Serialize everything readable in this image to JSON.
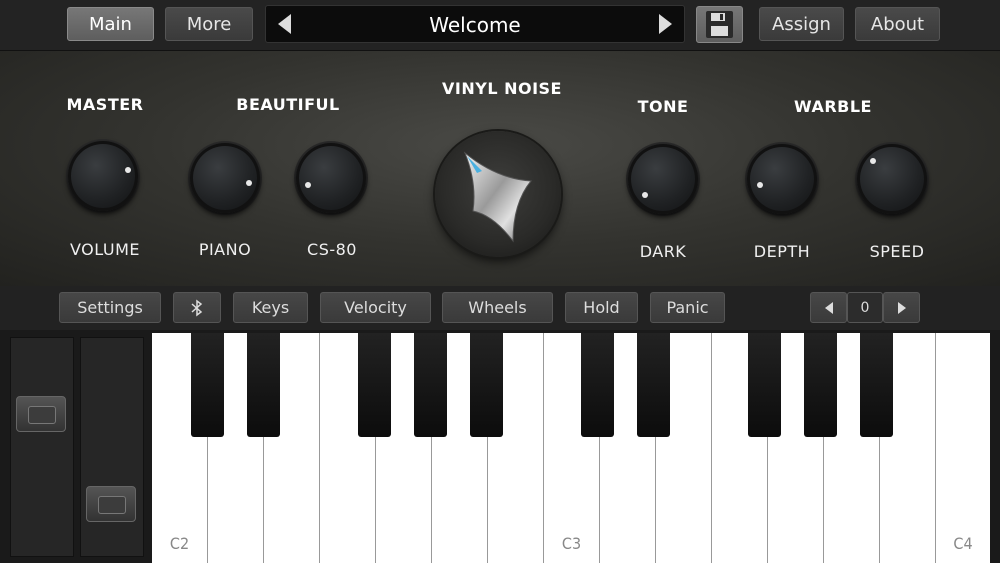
{
  "topbar": {
    "main_label": "Main",
    "more_label": "More",
    "preset_name": "Welcome",
    "save_icon": "floppy-disk-icon",
    "assign_label": "Assign",
    "about_label": "About"
  },
  "panel": {
    "master": {
      "title": "MASTER",
      "knob_label": "VOLUME"
    },
    "beautiful": {
      "title": "BEAUTIFUL",
      "knob1_label": "PIANO",
      "knob2_label": "CS-80"
    },
    "vinyl": {
      "title": "VINYL NOISE"
    },
    "tone": {
      "title": "TONE",
      "knob_label": "DARK"
    },
    "warble": {
      "title": "WARBLE",
      "knob1_label": "DEPTH",
      "knob2_label": "SPEED"
    }
  },
  "controls": {
    "settings_label": "Settings",
    "bluetooth_icon": "bluetooth-icon",
    "keys_label": "Keys",
    "velocity_label": "Velocity",
    "wheels_label": "Wheels",
    "hold_label": "Hold",
    "panic_label": "Panic",
    "octave_value": "0"
  },
  "keyboard": {
    "labels": [
      "C2",
      "C3",
      "C4"
    ]
  },
  "colors": {
    "accent": "#4ab0e0",
    "panel": "#33332f"
  }
}
